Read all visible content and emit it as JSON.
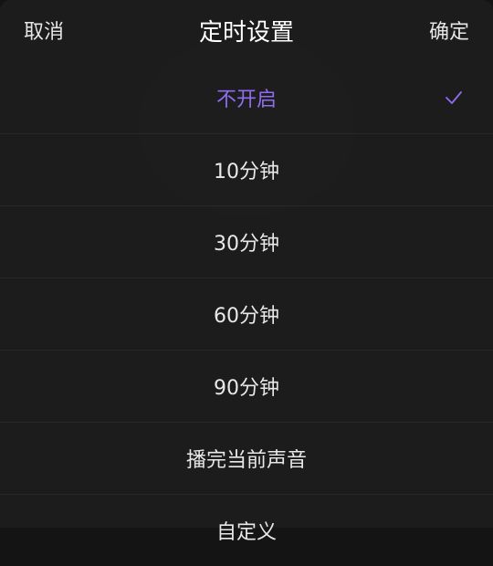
{
  "header": {
    "cancel_label": "取消",
    "title": "定时设置",
    "confirm_label": "确定"
  },
  "options": [
    {
      "label": "不开启",
      "selected": true
    },
    {
      "label": "10分钟",
      "selected": false
    },
    {
      "label": "30分钟",
      "selected": false
    },
    {
      "label": "60分钟",
      "selected": false
    },
    {
      "label": "90分钟",
      "selected": false
    },
    {
      "label": "播完当前声音",
      "selected": false
    },
    {
      "label": "自定义",
      "selected": false
    }
  ],
  "colors": {
    "accent": "#8f6cf0",
    "sheet_bg": "#1e1d1e",
    "text": "#e8e8e8"
  },
  "icons": {
    "selected_marker": "check-icon"
  }
}
